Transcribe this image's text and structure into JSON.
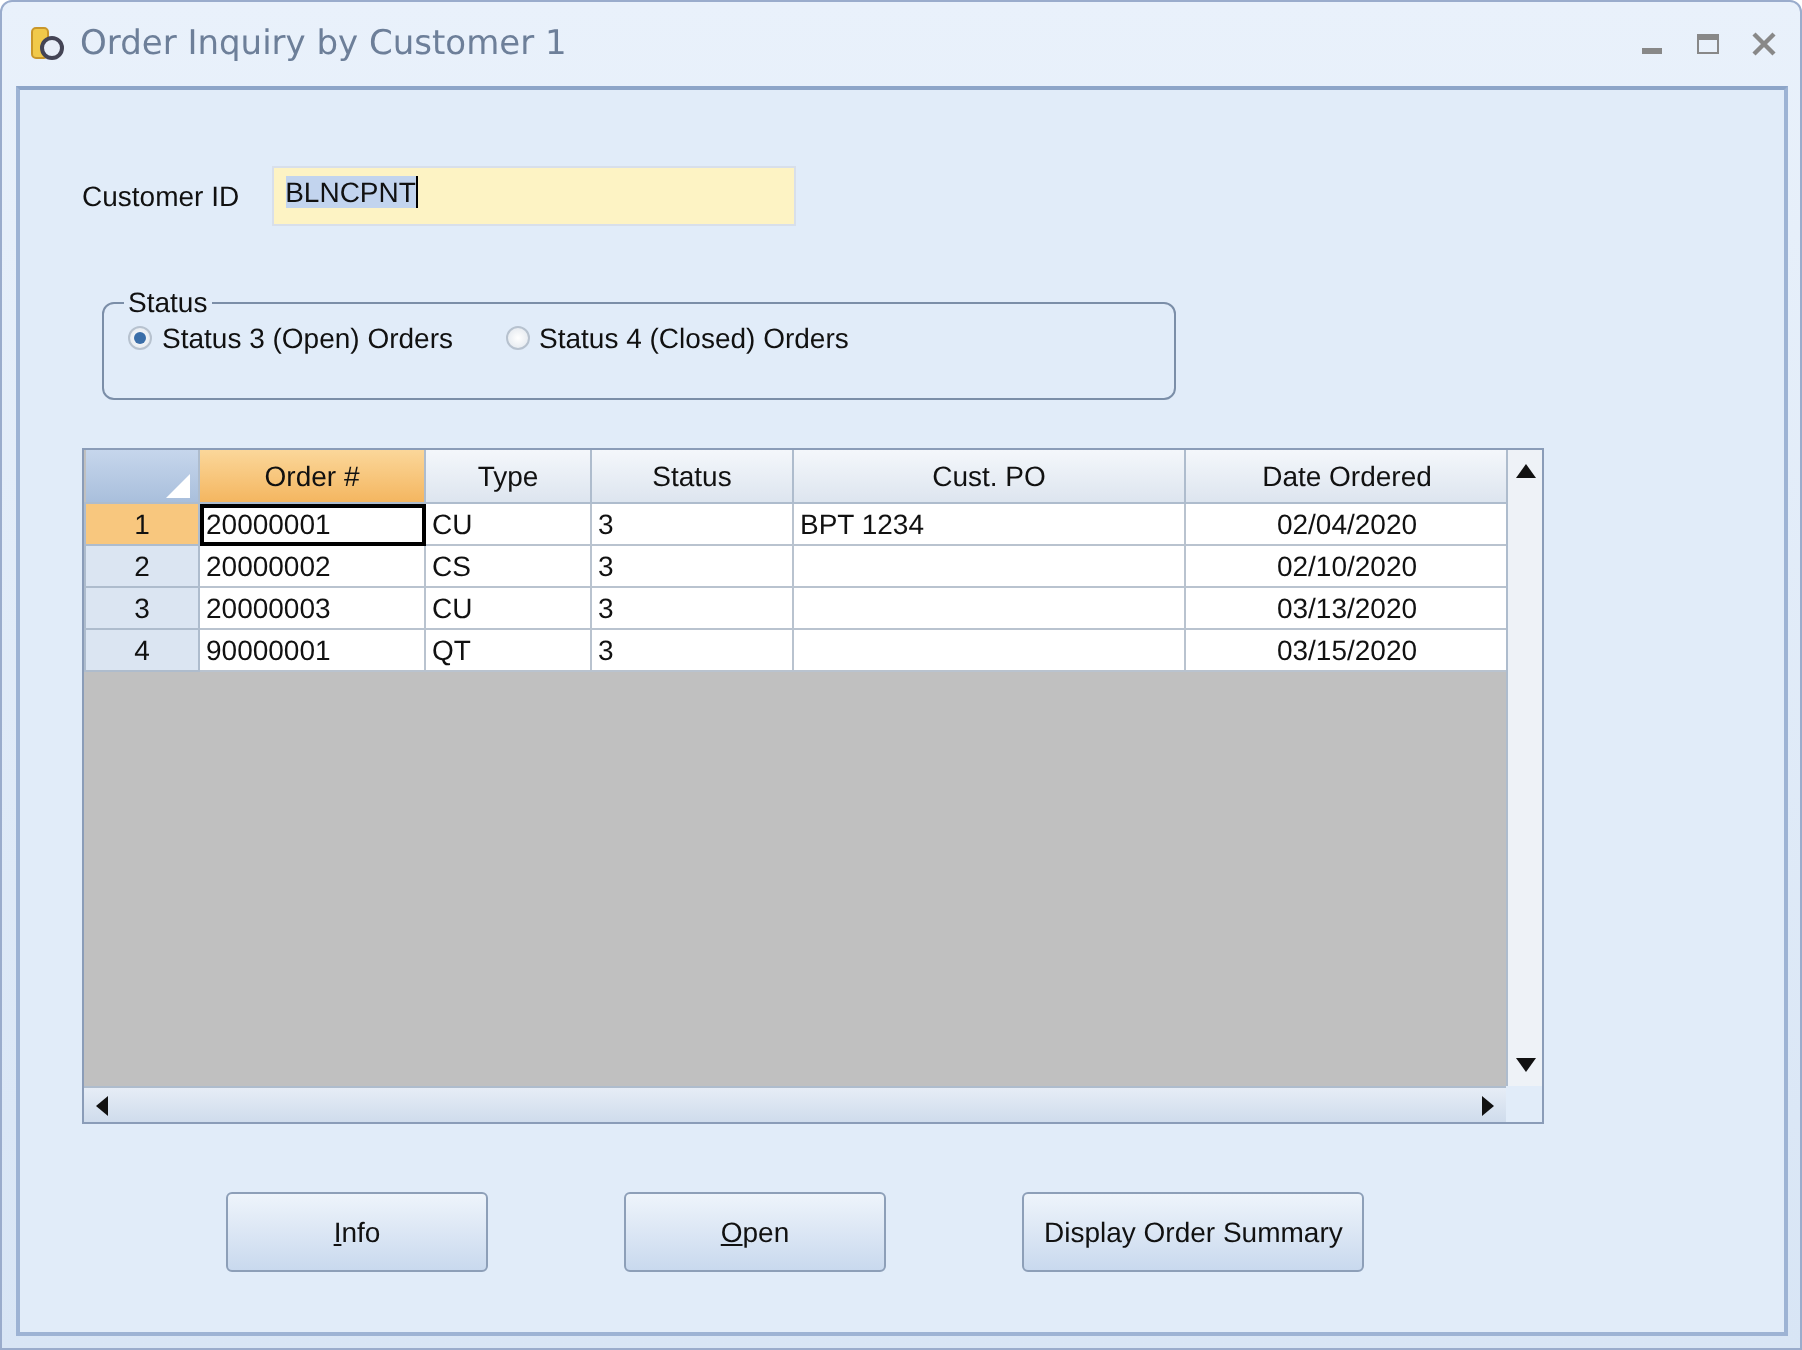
{
  "window": {
    "title": "Order Inquiry by Customer 1"
  },
  "customer_id": {
    "label": "Customer ID",
    "value": "BLNCPNT"
  },
  "status_group": {
    "title": "Status",
    "options": [
      {
        "label": "Status 3 (Open) Orders",
        "selected": true
      },
      {
        "label": "Status 4 (Closed) Orders",
        "selected": false
      }
    ]
  },
  "table": {
    "columns": [
      {
        "label": "Order #",
        "selected": true
      },
      {
        "label": "Type",
        "selected": false
      },
      {
        "label": "Status",
        "selected": false
      },
      {
        "label": "Cust. PO",
        "selected": false
      },
      {
        "label": "Date Ordered",
        "selected": false
      }
    ],
    "rows": [
      {
        "number": "1",
        "selected": true,
        "cells": [
          "20000001",
          "CU",
          "3",
          "BPT 1234",
          "02/04/2020"
        ]
      },
      {
        "number": "2",
        "selected": false,
        "cells": [
          "20000002",
          "CS",
          "3",
          "",
          "02/10/2020"
        ]
      },
      {
        "number": "3",
        "selected": false,
        "cells": [
          "20000003",
          "CU",
          "3",
          "",
          "03/13/2020"
        ]
      },
      {
        "number": "4",
        "selected": false,
        "cells": [
          "90000001",
          "QT",
          "3",
          "",
          "03/15/2020"
        ]
      }
    ]
  },
  "buttons": [
    {
      "label": "Info",
      "access_key_underlined": true
    },
    {
      "label": "Open",
      "access_key_underlined": true
    },
    {
      "label": "Display Order Summary",
      "access_key_underlined": false
    }
  ]
}
